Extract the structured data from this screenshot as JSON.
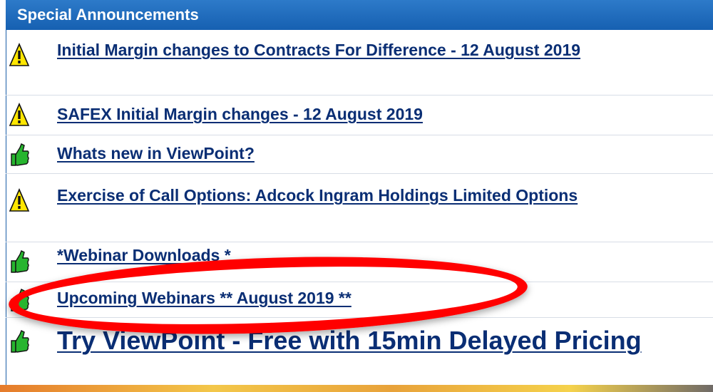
{
  "header": {
    "title": "Special Announcements"
  },
  "announcements": [
    {
      "icon": "warning-icon",
      "text": "Initial Margin changes to Contracts For Difference - 12 August 2019"
    },
    {
      "icon": "warning-icon",
      "text": "SAFEX Initial Margin changes - 12 August 2019"
    },
    {
      "icon": "thumbs-up-icon",
      "text": "Whats new in ViewPoint?"
    },
    {
      "icon": "warning-icon",
      "text": "Exercise of Call Options: Adcock Ingram Holdings Limited Options"
    },
    {
      "icon": "thumbs-up-icon",
      "text": "*Webinar Downloads *"
    },
    {
      "icon": "thumbs-up-icon",
      "text": "Upcoming Webinars ** August 2019 **"
    },
    {
      "icon": "thumbs-up-icon",
      "text": "Try ViewPoint - Free with 15min Delayed Pricing"
    }
  ],
  "colors": {
    "header_bg": "#1a66b8",
    "link": "#0a2e74",
    "warning_yellow": "#ffe600",
    "thumb_green": "#27b52f",
    "highlight_red": "#ff0000"
  }
}
